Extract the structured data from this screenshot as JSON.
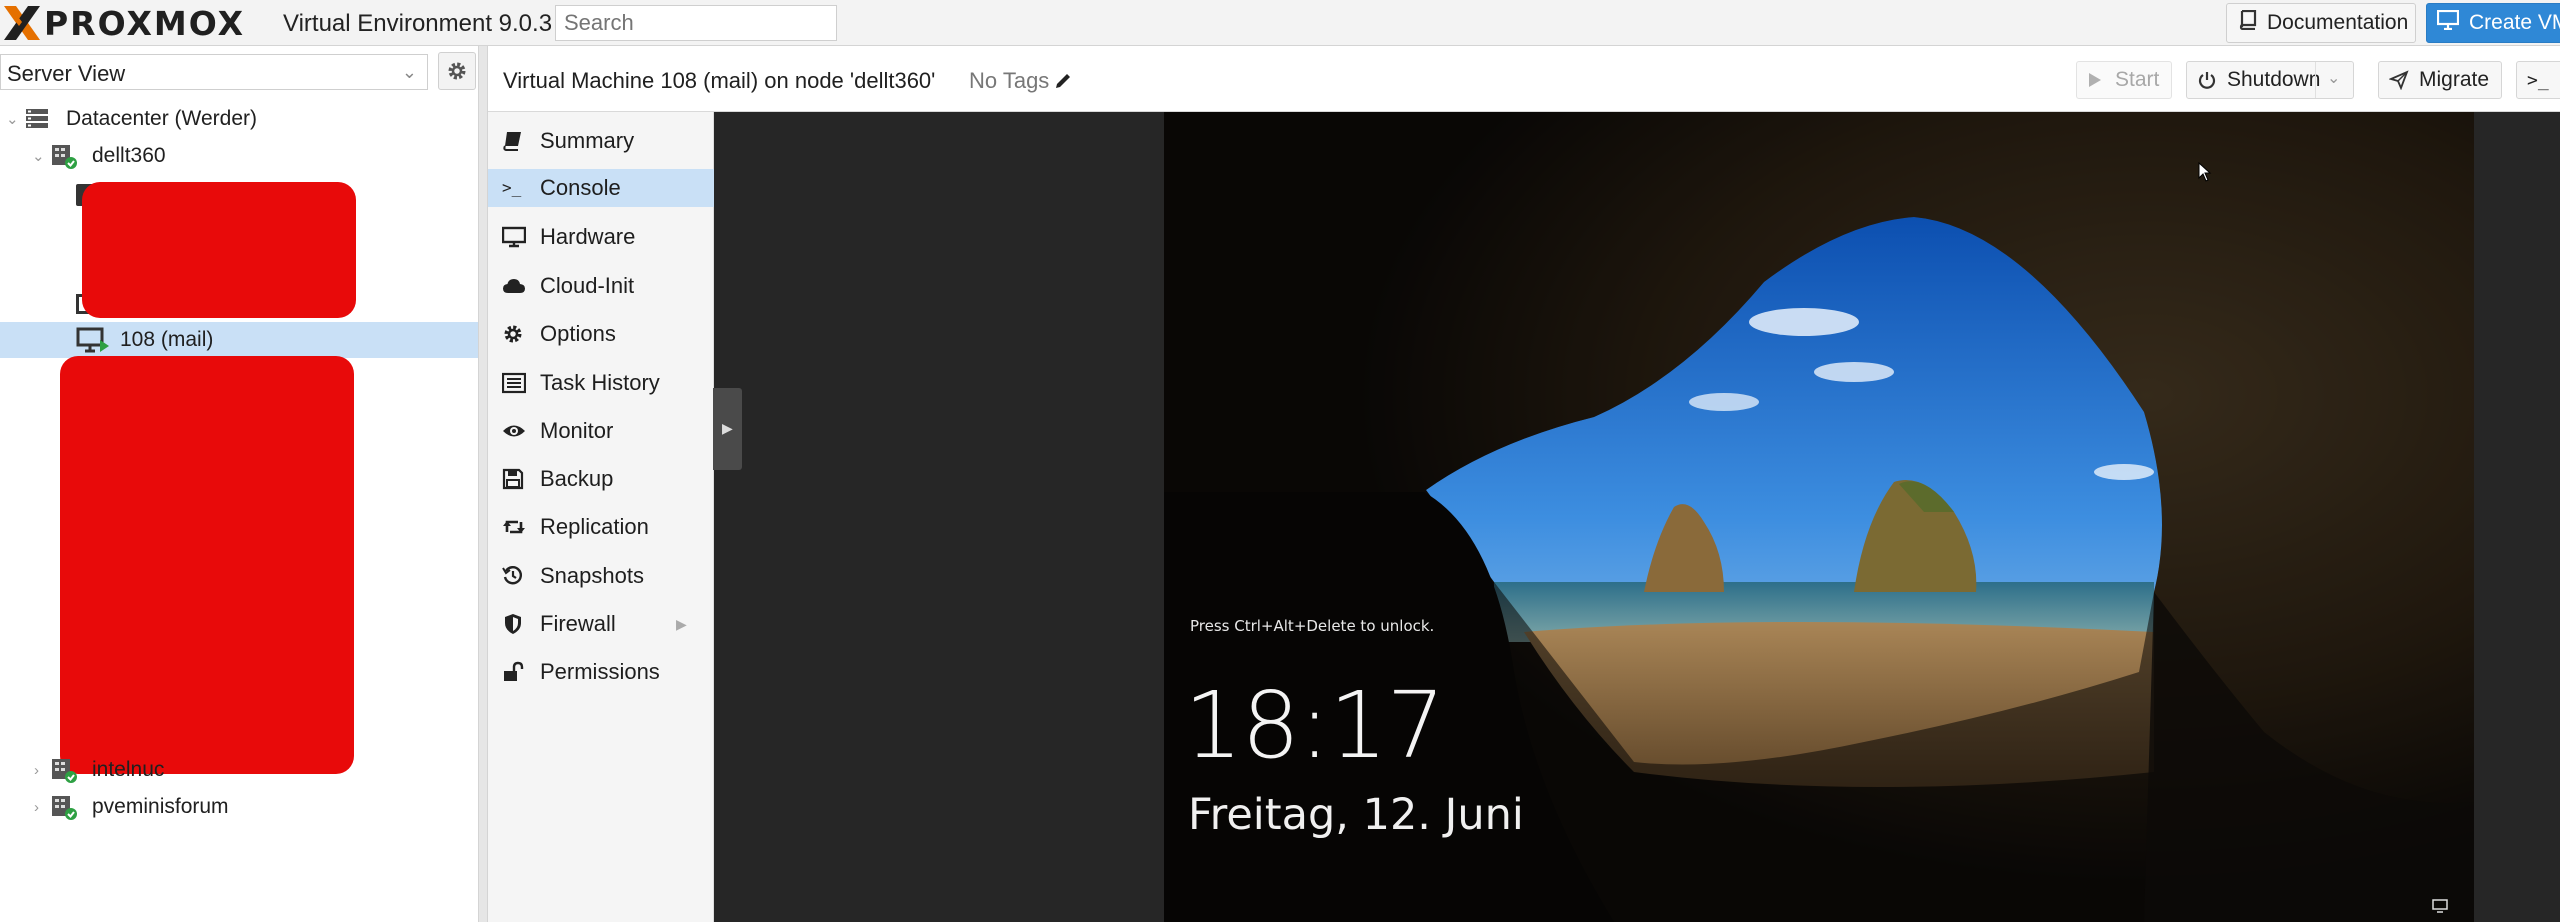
{
  "header": {
    "logo_text": "PROXMOX",
    "product_title": "Virtual Environment 9.0.3",
    "search_placeholder": "Search",
    "docs_label": "Documentation",
    "create_vm_label": "Create VM",
    "logo_accent": "#e57000"
  },
  "left": {
    "view_label": "Server View",
    "tree": {
      "datacenter": "Datacenter (Werder)",
      "node1": "dellt360",
      "vm_selected": "108 (mail)",
      "partial_suffix": ")",
      "node2": "intelnuc",
      "node3": "pveminisforum"
    }
  },
  "content": {
    "vm_title": "Virtual Machine 108 (mail) on node 'dellt360'",
    "tags_label": "No Tags",
    "toolbar": {
      "start": "Start",
      "shutdown": "Shutdown",
      "migrate": "Migrate",
      "console_prompt": ">_"
    }
  },
  "subnav": {
    "items": [
      {
        "label": "Summary",
        "icon": "book-icon"
      },
      {
        "label": "Console",
        "icon": "terminal-icon"
      },
      {
        "label": "Hardware",
        "icon": "monitor-icon"
      },
      {
        "label": "Cloud-Init",
        "icon": "cloud-icon"
      },
      {
        "label": "Options",
        "icon": "gear-icon"
      },
      {
        "label": "Task History",
        "icon": "list-icon"
      },
      {
        "label": "Monitor",
        "icon": "eye-icon"
      },
      {
        "label": "Backup",
        "icon": "floppy-icon"
      },
      {
        "label": "Replication",
        "icon": "retweet-icon"
      },
      {
        "label": "Snapshots",
        "icon": "history-icon"
      },
      {
        "label": "Firewall",
        "icon": "shield-icon"
      },
      {
        "label": "Permissions",
        "icon": "unlock-icon"
      }
    ],
    "active": "Console"
  },
  "console": {
    "lock_hint": "Press Ctrl+Alt+Delete to unlock.",
    "time": "18:17",
    "date": "Freitag, 12. Juni"
  },
  "colors": {
    "selection": "#c9e0f6",
    "primary_button": "#2f88d6",
    "redaction": "#e80a0a",
    "status_ok": "#2ea043"
  }
}
